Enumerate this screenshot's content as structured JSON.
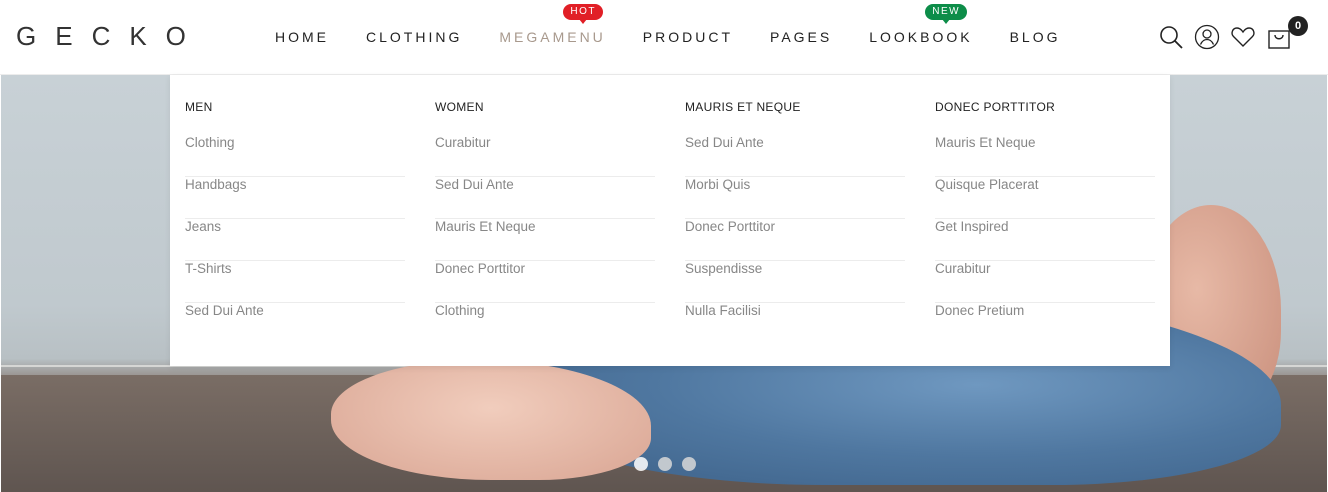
{
  "logo": "GECKO",
  "nav": {
    "items": [
      {
        "label": "HOME"
      },
      {
        "label": "CLOTHING"
      },
      {
        "label": "MEGAMENU",
        "badge": "HOT"
      },
      {
        "label": "PRODUCT"
      },
      {
        "label": "PAGES"
      },
      {
        "label": "LOOKBOOK",
        "badge": "NEW"
      },
      {
        "label": "BLOG"
      }
    ]
  },
  "header_icons": {
    "search": "search-icon",
    "account": "user-icon",
    "wishlist": "heart-icon",
    "cart": "cart-icon",
    "cart_count": "0"
  },
  "megamenu": {
    "columns": [
      {
        "title": "MEN",
        "links": [
          "Clothing",
          "Handbags",
          "Jeans",
          "T-Shirts",
          "Sed Dui Ante"
        ]
      },
      {
        "title": "WOMEN",
        "links": [
          "Curabitur",
          "Sed Dui Ante",
          "Mauris Et Neque",
          "Donec Porttitor",
          "Clothing"
        ]
      },
      {
        "title": "MAURIS ET NEQUE",
        "links": [
          "Sed Dui Ante",
          "Morbi Quis",
          "Donec Porttitor",
          "Suspendisse",
          "Nulla Facilisi"
        ]
      },
      {
        "title": "DONEC PORTTITOR",
        "links": [
          "Mauris Et Neque",
          "Quisque Placerat",
          "Get Inspired",
          "Curabitur",
          "Donec Pretium"
        ]
      }
    ]
  },
  "slider": {
    "dots": 3,
    "active": 1
  },
  "colors": {
    "hot": "#e11f26",
    "new": "#0d8d49",
    "active_nav": "#a8998d"
  }
}
